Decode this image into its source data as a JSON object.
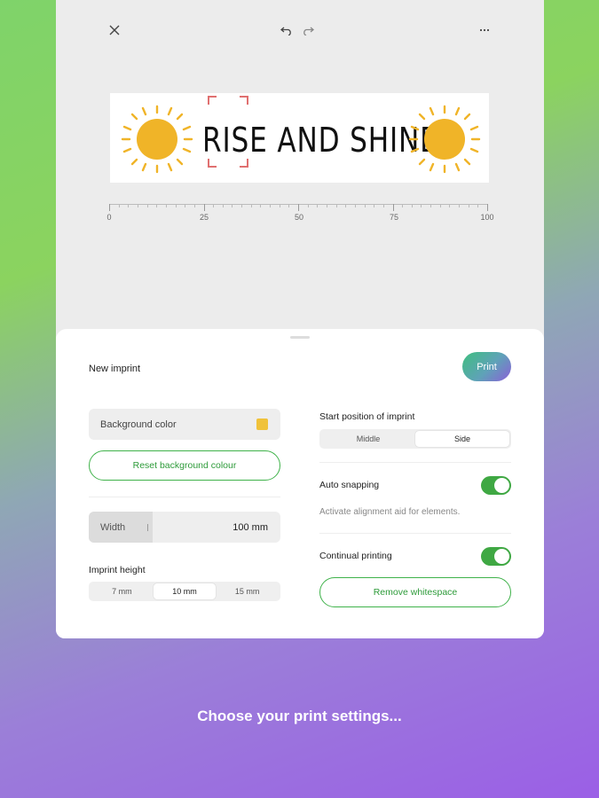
{
  "toolbar": {
    "close_icon": "close-icon",
    "undo_icon": "undo-icon",
    "redo_icon": "redo-icon",
    "more_icon": "more-icon"
  },
  "canvas": {
    "imprint_text": "RISE AND SHINE",
    "ruler_labels": [
      "0",
      "25",
      "50",
      "75",
      "100"
    ],
    "sun_color": "#f0b428"
  },
  "sheet": {
    "title": "New imprint",
    "print_label": "Print",
    "background_color_label": "Background color",
    "background_color_value": "#f0c23a",
    "reset_label": "Reset background colour",
    "width_label": "Width",
    "width_value": "100 mm",
    "imprint_height_label": "Imprint height",
    "imprint_height_options": [
      "7 mm",
      "10 mm",
      "15 mm"
    ],
    "imprint_height_selected": "10 mm",
    "start_position_label": "Start position of imprint",
    "start_position_options": [
      "Middle",
      "Side"
    ],
    "start_position_selected": "Side",
    "auto_snapping_label": "Auto snapping",
    "auto_snapping_on": true,
    "auto_snapping_hint": "Activate alignment aid for elements.",
    "continual_printing_label": "Continual printing",
    "continual_printing_on": true,
    "remove_whitespace_label": "Remove whitespace"
  },
  "caption": "Choose your print settings..."
}
